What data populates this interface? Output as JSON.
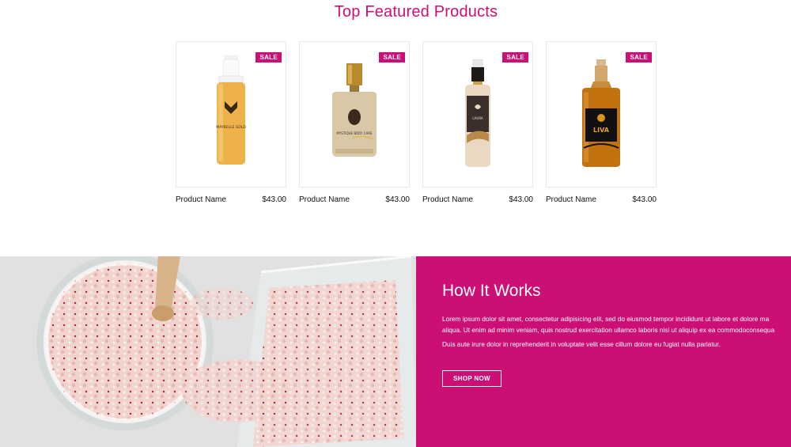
{
  "featured": {
    "title": "Top Featured Products",
    "products": [
      {
        "name": "Product Name",
        "price": "$43.00",
        "badge": "SALE",
        "label": "MAYBELLE GOLD"
      },
      {
        "name": "Product Name",
        "price": "$43.00",
        "badge": "SALE",
        "label": "MYSTIQUE BODY CARE"
      },
      {
        "name": "Product Name",
        "price": "$43.00",
        "badge": "SALE",
        "label": "LAURA"
      },
      {
        "name": "Product Name",
        "price": "$43.00",
        "badge": "SALE",
        "label": "LIVA"
      }
    ]
  },
  "how_it_works": {
    "title": "How It Works",
    "paragraph_1_line_1": "Lorem ipsum dolor sit amet, consectetur adipisicing elit, sed do eiusmod tempor incididunt ut labore et dolore ma",
    "paragraph_1_line_2": "aliqua. Ut enim ad minim veniam, quis nostrud exercitation ullamco laboris nisi ut aliquip ex ea commodoconsequa",
    "paragraph_2": "Duis aute irure dolor in reprehenderit in voluptate velit esse cillum dolore eu fugiat nulla pariatur.",
    "button_label": "SHOP NOW"
  },
  "colors": {
    "accent": "#cc0f74",
    "card_border": "#e6e6e6"
  }
}
